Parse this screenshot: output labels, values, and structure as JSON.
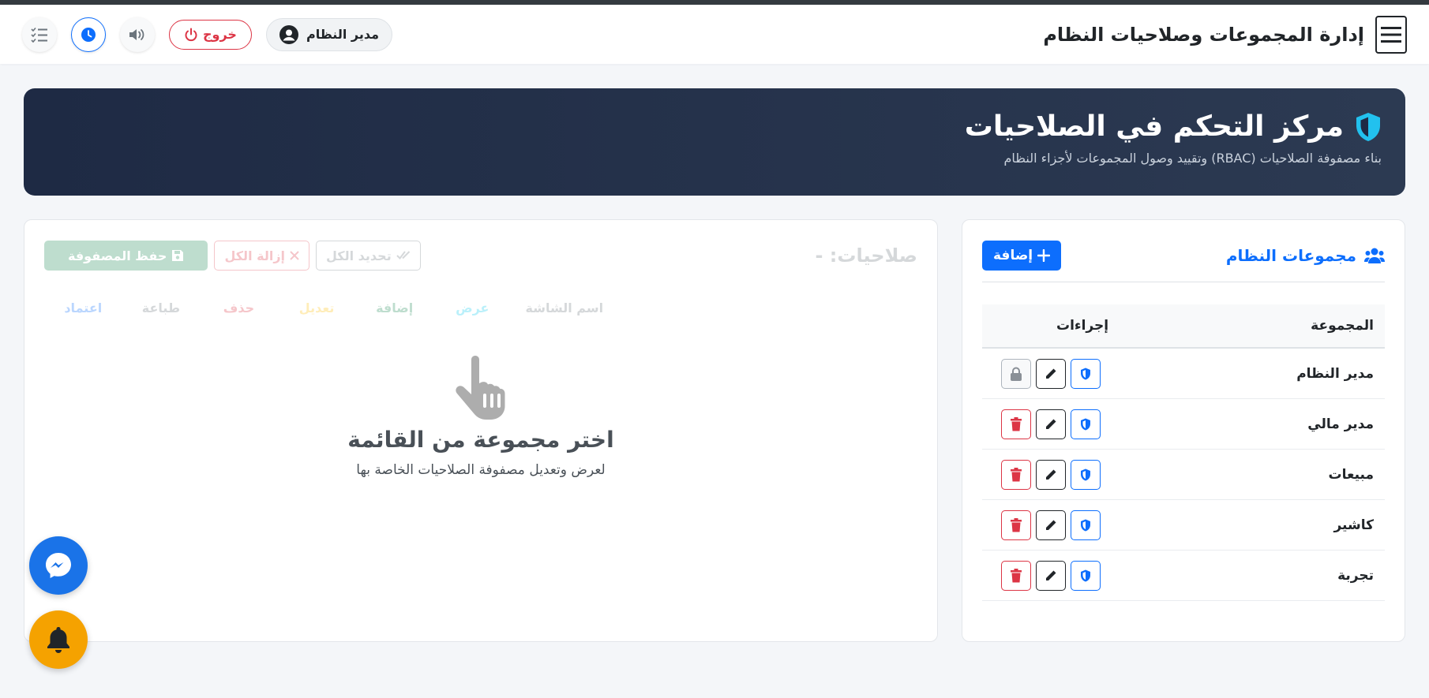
{
  "nav": {
    "title": "إدارة المجموعات وصلاحيات النظام",
    "user_label": "مدير النظام",
    "logout_label": "خروج"
  },
  "hero": {
    "title": "مركز التحكم في الصلاحيات",
    "subtitle": "بناء مصفوفة الصلاحيات (RBAC) وتقييد وصول المجموعات لأجزاء النظام"
  },
  "groups": {
    "title": "مجموعات النظام",
    "add_label": "إضافة",
    "col_group": "المجموعة",
    "col_actions": "إجراءات",
    "rows": [
      {
        "name": "مدير النظام",
        "locked": true
      },
      {
        "name": "مدير مالي",
        "locked": false
      },
      {
        "name": "مبيعات",
        "locked": false
      },
      {
        "name": "كاشير",
        "locked": false
      },
      {
        "name": "تجربة",
        "locked": false
      }
    ]
  },
  "matrix": {
    "title": "صلاحيات: -",
    "select_all_label": "تحديد الكل",
    "clear_all_label": "إزالة الكل",
    "save_label": "حفظ المصفوفة",
    "columns": [
      "اسم الشاشة",
      "عرض",
      "إضافة",
      "تعديل",
      "حذف",
      "طباعة",
      "اعتماد"
    ],
    "column_colors": [
      "#6c757d",
      "#0dcaf0",
      "#198754",
      "#ffc107",
      "#dc3545",
      "#6c757d",
      "#0d6efd"
    ],
    "empty_title": "اختر مجموعة من القائمة",
    "empty_subtitle": "لعرض وتعديل مصفوفة الصلاحيات الخاصة بها"
  },
  "colors": {
    "primary": "#0d6efd",
    "danger": "#dc3545",
    "hero_bg": "#1e2a44",
    "shield": "#22c1ee",
    "bell_fab": "#f5a200",
    "messenger_fab": "#1a73e8"
  }
}
